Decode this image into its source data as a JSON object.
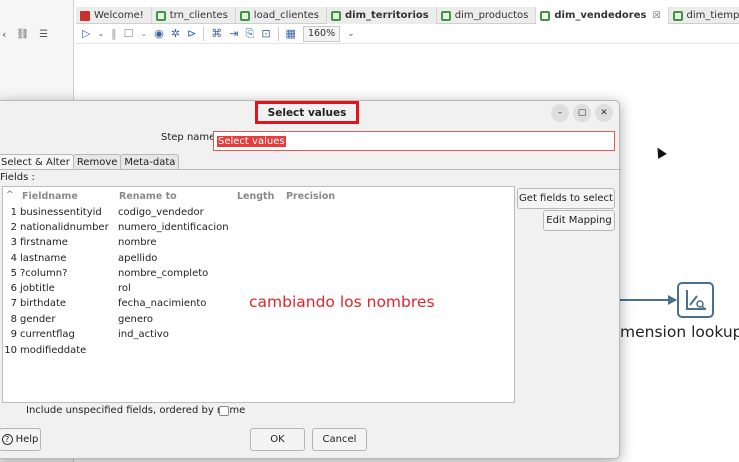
{
  "editor_tabs": [
    {
      "label": "Welcome!",
      "icon": "red-app-icon",
      "active": false
    },
    {
      "label": "trn_clientes",
      "icon": "transformation-icon",
      "active": false
    },
    {
      "label": "load_clientes",
      "icon": "transformation-icon",
      "active": false
    },
    {
      "label": "dim_territorios",
      "icon": "transformation-icon",
      "active": false
    },
    {
      "label": "dim_productos",
      "icon": "transformation-icon",
      "active": false
    },
    {
      "label": "dim_vendedores",
      "icon": "transformation-icon",
      "active": true,
      "close": "☒"
    },
    {
      "label": "dim_tiempo",
      "icon": "transformation-icon",
      "active": false
    }
  ],
  "toolbar": {
    "zoom": "160%"
  },
  "canvas": {
    "step_label": "mension lookup/u"
  },
  "dialog": {
    "title": "Select values",
    "step_name_label": "Step name",
    "step_name_value": "Select values",
    "tabs": [
      "Select & Alter",
      "Remove",
      "Meta-data"
    ],
    "fields_label": "Fields :",
    "columns": [
      "Fieldname",
      "Rename to",
      "Length",
      "Precision"
    ],
    "rows": [
      {
        "num": "1",
        "field": "businessentityid",
        "rename": "codigo_vendedor"
      },
      {
        "num": "2",
        "field": "nationalidnumber",
        "rename": "numero_identificacion"
      },
      {
        "num": "3",
        "field": "firstname",
        "rename": "nombre"
      },
      {
        "num": "4",
        "field": "lastname",
        "rename": "apellido"
      },
      {
        "num": "5",
        "field": "?column?",
        "rename": "nombre_completo"
      },
      {
        "num": "6",
        "field": "jobtitle",
        "rename": "rol"
      },
      {
        "num": "7",
        "field": "birthdate",
        "rename": "fecha_nacimiento"
      },
      {
        "num": "8",
        "field": "gender",
        "rename": "genero"
      },
      {
        "num": "9",
        "field": "currentflag",
        "rename": "ind_activo"
      },
      {
        "num": "10",
        "field": "modifieddate",
        "rename": ""
      }
    ],
    "annotation": "cambiando los nombres",
    "get_fields_label": "Get fields to select",
    "edit_mapping_label": "Edit Mapping",
    "include_label": "Include unspecified fields, ordered by name",
    "help_label": "Help",
    "ok_label": "OK",
    "cancel_label": "Cancel"
  }
}
